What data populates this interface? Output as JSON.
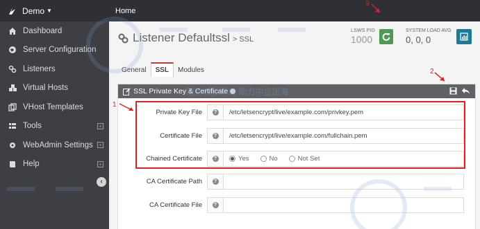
{
  "brand": {
    "label": "Demo"
  },
  "breadcrumb": "Home",
  "nav": [
    {
      "label": "Dashboard",
      "icon": "dashboard-icon",
      "expandable": false
    },
    {
      "label": "Server Configuration",
      "icon": "globe-icon",
      "expandable": false
    },
    {
      "label": "Listeners",
      "icon": "link-icon",
      "expandable": false
    },
    {
      "label": "Virtual Hosts",
      "icon": "cubes-icon",
      "expandable": false
    },
    {
      "label": "VHost Templates",
      "icon": "templates-icon",
      "expandable": false
    },
    {
      "label": "Tools",
      "icon": "tools-icon",
      "expandable": true
    },
    {
      "label": "WebAdmin Settings",
      "icon": "gear-icon",
      "expandable": true
    },
    {
      "label": "Help",
      "icon": "book-icon",
      "expandable": true
    }
  ],
  "page": {
    "title": "Listener Defaultssl",
    "subtitle": "> SSL",
    "pid_label": "LSWS PID",
    "pid_value": "1000",
    "load_label": "SYSTEM LOAD AVG",
    "load_value": "0, 0, 0"
  },
  "tabs": [
    {
      "label": "General",
      "active": false
    },
    {
      "label": "SSL",
      "active": true
    },
    {
      "label": "Modules",
      "active": false
    }
  ],
  "panel": {
    "title": "SSL Private Key & Certificate",
    "fields": [
      {
        "label": "Private Key File",
        "value": "/etc/letsencrypt/live/example.com/privkey.pem"
      },
      {
        "label": "Certificate File",
        "value": "/etc/letsencrypt/live/example.com/fullchain.pem"
      },
      {
        "label": "Chained Certificate",
        "options": [
          "Yes",
          "No",
          "Not Set"
        ],
        "selected": "Yes"
      },
      {
        "label": "CA Certificate Path",
        "value": ""
      },
      {
        "label": "CA Certificate File",
        "value": ""
      }
    ]
  },
  "annotations": {
    "a1": "1",
    "a2": "2",
    "a3": "3"
  },
  "watermark": {
    "text": "服务商推荐商 助力中企出海"
  },
  "colors": {
    "sidebar": "#3d3f45",
    "topbar": "#2e3035",
    "accent_red": "#e02020",
    "restart_green": "#4e9a55",
    "graph_blue": "#1f7a9a"
  }
}
